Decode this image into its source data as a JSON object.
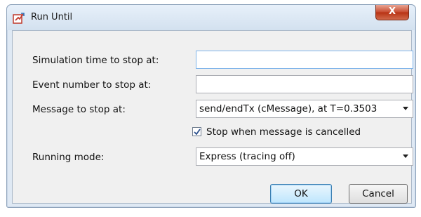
{
  "window": {
    "title": "Run Until",
    "close_label": "X"
  },
  "form": {
    "sim_time_label": "Simulation time to stop at:",
    "sim_time_value": "",
    "event_number_label": "Event number to stop at:",
    "event_number_value": "",
    "message_label": "Message to stop at:",
    "message_value": "send/endTx (cMessage), at T=0.3503",
    "stop_cancelled_label": "Stop when message is cancelled",
    "stop_cancelled_checked": true,
    "running_mode_label": "Running mode:",
    "running_mode_value": "Express (tracing off)"
  },
  "buttons": {
    "ok_label": "OK",
    "cancel_label": "Cancel"
  },
  "icons": {
    "title_icon": "run-until-icon",
    "close_icon": "close-icon",
    "dropdown_icon": "chevron-down-icon",
    "check_icon": "checkmark-icon"
  }
}
